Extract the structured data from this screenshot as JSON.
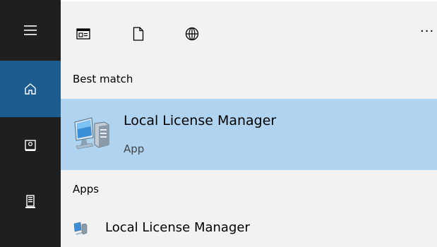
{
  "rail": {
    "items": [
      {
        "name": "hamburger-menu",
        "icon": "menu-icon"
      },
      {
        "name": "home",
        "icon": "home-icon",
        "active": true
      },
      {
        "name": "documents",
        "icon": "document-icon"
      },
      {
        "name": "device",
        "icon": "device-icon"
      }
    ]
  },
  "toolbar": {
    "icons": [
      "apps-filter-icon",
      "documents-filter-icon",
      "web-filter-icon"
    ],
    "more": "···"
  },
  "best_match": {
    "label": "Best match",
    "title": "Local License Manager",
    "subtitle": "App",
    "icon": "computer-app-icon"
  },
  "apps": {
    "label": "Apps",
    "items": [
      {
        "title": "Local License Manager",
        "icon": "computer-app-icon"
      }
    ]
  },
  "colors": {
    "rail_bg": "#1f1f1f",
    "rail_active": "#1c5c8f",
    "content_bg": "#f2f2f2",
    "selection": "#b0d4ef"
  }
}
